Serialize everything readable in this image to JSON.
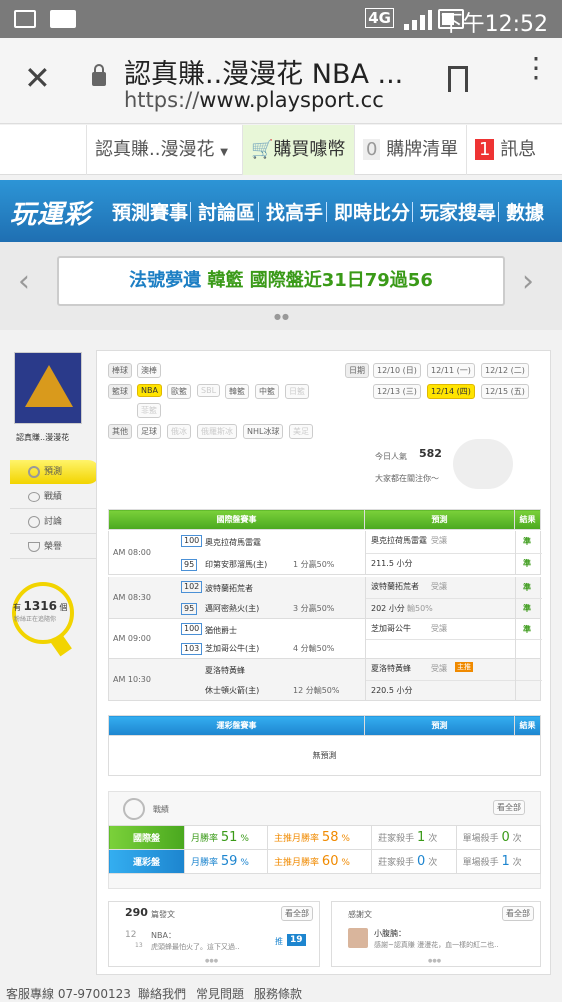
{
  "status": {
    "network": "4G",
    "time": "下午12:52"
  },
  "browser": {
    "title": "認真賺..漫漫花 NBA ...",
    "url_scheme": "https://",
    "url_host": "www.playsport.cc"
  },
  "topbar": {
    "user": "認真賺..漫漫花",
    "buy": "購買噱幣",
    "cart_count": "0",
    "cart": "購牌清單",
    "msg_count": "1",
    "msg": "訊息"
  },
  "nav": {
    "logo": "玩運彩",
    "items": [
      "預測賽事",
      "討論區",
      "找高手",
      "即時比分",
      "玩家搜尋",
      "數據"
    ]
  },
  "banner": {
    "part1": "法號夢遺",
    "part2": "韓籃",
    "part3": "國際盤近31日79過56"
  },
  "profile": {
    "name": "認真賺..漫漫花",
    "menu": [
      "預測",
      "戰績",
      "討論",
      "榮譽"
    ],
    "fans_count": "1316",
    "fans_prefix": "有",
    "fans_suffix": "個",
    "fans_line2": "粉絲正在追隨你"
  },
  "filters": {
    "baseball_label": "棒球",
    "baseball": [
      "澳棒"
    ],
    "basketball_label": "籃球",
    "basketball": [
      "NBA",
      "歐籃",
      "SBL",
      "韓籃",
      "中籃",
      "日籃",
      "菲籃"
    ],
    "other_label": "其他",
    "other": [
      "足球",
      "俄冰",
      "俄羅斯冰",
      "NHL冰球",
      "美足"
    ],
    "date_label": "日期",
    "dates": [
      "12/10 (日)",
      "12/11 (一)",
      "12/12 (二)",
      "12/13 (三)",
      "12/14 (四)",
      "12/15 (五)"
    ],
    "popularity_label": "今日人氣",
    "popularity": "582",
    "watching": "大家都在關注你～"
  },
  "intl": {
    "headers": [
      "國際盤賽事",
      "預測",
      "結果"
    ],
    "games": [
      {
        "time": "AM 08:00",
        "s1": "100",
        "s2": "95",
        "team1": "奧克拉荷馬雷霆",
        "team2": "印第安那溜馬(主)",
        "line": "1 分贏50%",
        "pick": "奧克拉荷馬雷霆",
        "pick_tag": "受讓",
        "ou": "211.5 小分",
        "r1": "準",
        "r2": "準"
      },
      {
        "time": "AM 08:30",
        "s1": "102",
        "s2": "95",
        "team1": "波特蘭拓荒者",
        "team2": "邁阿密熱火(主)",
        "line": "3 分贏50%",
        "pick": "波特蘭拓荒者",
        "pick_tag": "受讓",
        "ou": "202 小分",
        "ou_tag": "輸50%",
        "r1": "準",
        "r2": "準"
      },
      {
        "time": "AM 09:00",
        "s1": "100",
        "s2": "103",
        "team1": "猶他爵士",
        "team2": "芝加哥公牛(主)",
        "line": "4 分輸50%",
        "pick": "芝加哥公牛",
        "pick_tag": "受讓",
        "ou": "",
        "r1": "準",
        "r2": ""
      },
      {
        "time": "AM 10:30",
        "s1": "",
        "s2": "",
        "team1": "夏洛特黃蜂",
        "team2": "休士頓火箭(主)",
        "line": "12 分輸50%",
        "pick": "夏洛特黃蜂",
        "pick_tag": "受讓",
        "pick_badge": "主推",
        "ou": "220.5 小分",
        "r1": "",
        "r2": ""
      }
    ]
  },
  "lottery": {
    "headers": [
      "運彩盤賽事",
      "預測",
      "結果"
    ],
    "empty": "無預測"
  },
  "record": {
    "title": "戰績",
    "view_all": "看全部",
    "rows": [
      {
        "label": "國際盤",
        "month_label": "月勝率",
        "month": "51",
        "main_label": "主推月勝率",
        "main": "58",
        "kill_label": "莊家殺手",
        "kill": "1",
        "single_label": "單場殺手",
        "single": "0",
        "unit": "次",
        "pct": "%"
      },
      {
        "label": "運彩盤",
        "month_label": "月勝率",
        "month": "59",
        "main_label": "主推月勝率",
        "main": "60",
        "kill_label": "莊家殺手",
        "kill": "0",
        "single_label": "單場殺手",
        "single": "1",
        "unit": "次",
        "pct": "%"
      }
    ]
  },
  "posts": {
    "count": "290",
    "label": "篇發文",
    "view_all": "看全部",
    "day": "12",
    "day2": "13",
    "board": "NBA：",
    "snippet": "虎頭蜂最怕火了。這下又過..",
    "push": "推",
    "push_count": "19"
  },
  "thanks": {
    "label": "感謝文",
    "view_all": "看全部",
    "user": "小腹腩：",
    "snippet": "感謝~認真賺 漫漫花，血一樣的紅二也.."
  },
  "footer": {
    "phone": "客服專線 07-9700123",
    "links": [
      "聯絡我們",
      "常見問題",
      "服務條款"
    ]
  }
}
